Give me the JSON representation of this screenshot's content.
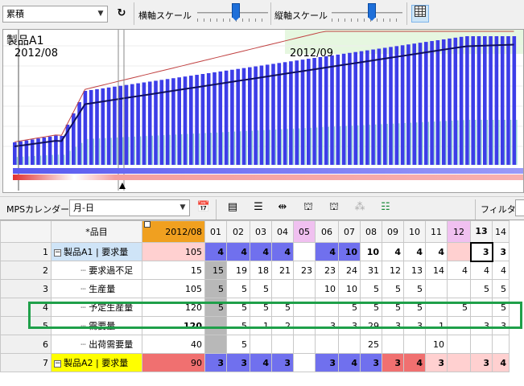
{
  "toolbar": {
    "mode_select": "累積",
    "refresh_icon": "refresh-icon",
    "h_scale_label": "横軸スケール",
    "v_scale_label": "縦軸スケール",
    "grid_icon": "grid-icon"
  },
  "chart": {
    "title": "製品A1",
    "date_left": "2012/08",
    "date_right": "2012/09",
    "colors": {
      "bar": "#3d3de8",
      "line_dark": "#101060",
      "line_red": "#c04040"
    }
  },
  "toolbar2": {
    "calendar_label": "MPSカレンダー",
    "calendar_value": "月-日",
    "filter_label": "フィルタ"
  },
  "grid": {
    "item_header": "*品目",
    "month_header": "2012/08",
    "days": [
      "01",
      "02",
      "03",
      "04",
      "05",
      "06",
      "07",
      "08",
      "09",
      "10",
      "11",
      "12",
      "13",
      "14"
    ],
    "rows": [
      {
        "no": "1",
        "label": "製品A1 | 要求量",
        "total": "105",
        "cells": [
          "4",
          "4",
          "4",
          "4",
          "",
          "4",
          "10",
          "10",
          "4",
          "4",
          "4",
          "",
          "3",
          "3"
        ]
      },
      {
        "no": "2",
        "label": "要求過不足",
        "total": "15",
        "cells": [
          "15",
          "19",
          "18",
          "21",
          "23",
          "23",
          "24",
          "31",
          "12",
          "13",
          "14",
          "4",
          "4",
          "4"
        ]
      },
      {
        "no": "3",
        "label": "生産量",
        "total": "105",
        "cells": [
          "5",
          "5",
          "5",
          "",
          "",
          "10",
          "10",
          "5",
          "5",
          "5",
          "",
          "",
          "5",
          "5"
        ]
      },
      {
        "no": "4",
        "label": "予定生産量",
        "total": "120",
        "cells": [
          "5",
          "5",
          "5",
          "5",
          "",
          "",
          "5",
          "5",
          "5",
          "5",
          "",
          "5",
          "",
          "5"
        ]
      },
      {
        "no": "5",
        "label": "需要量",
        "total": "120",
        "cells": [
          "",
          "5",
          "1",
          "2",
          "",
          "3",
          "3",
          "29",
          "3",
          "3",
          "1",
          "",
          "3",
          "3"
        ]
      },
      {
        "no": "6",
        "label": "出荷需要量",
        "total": "40",
        "cells": [
          "",
          "5",
          "",
          "",
          "",
          "",
          "",
          "25",
          "",
          "",
          "10",
          "",
          "",
          ""
        ]
      },
      {
        "no": "7",
        "label": "製品A2 | 要求量",
        "total": "90",
        "cells": [
          "3",
          "3",
          "4",
          "3",
          "",
          "3",
          "4",
          "3",
          "3",
          "4",
          "3",
          "",
          "3",
          "4"
        ]
      }
    ]
  }
}
